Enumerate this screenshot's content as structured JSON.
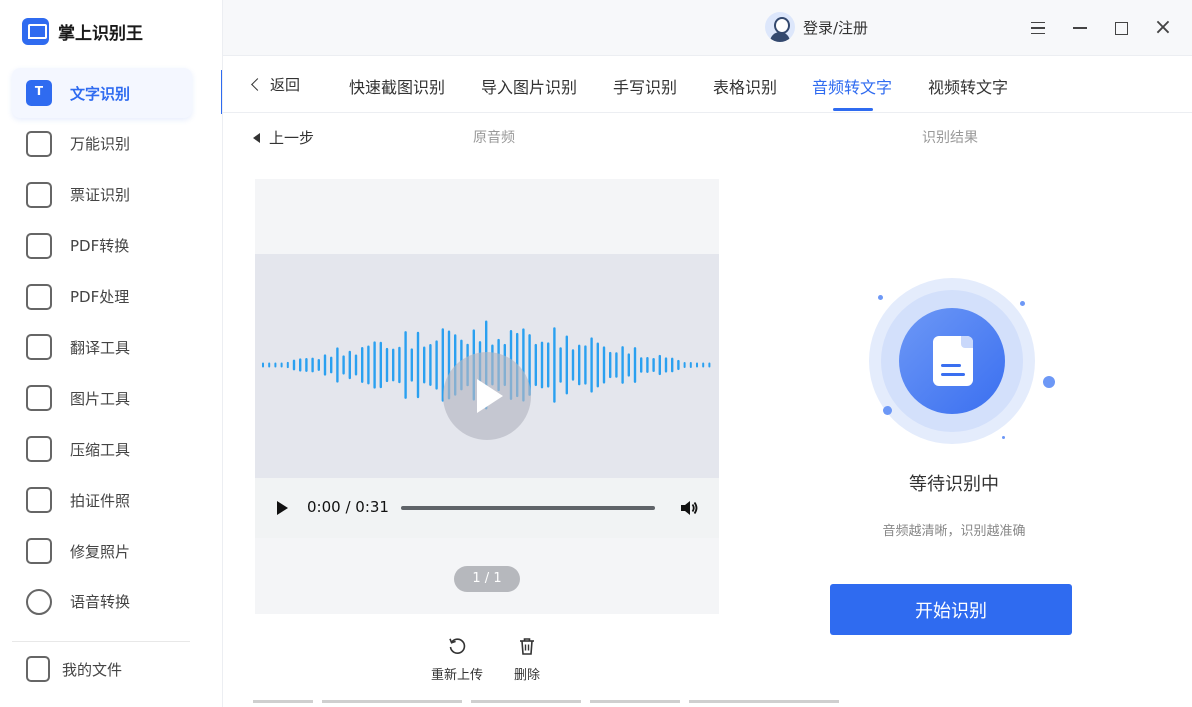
{
  "app": {
    "name": "掌上识别王"
  },
  "sidebar": {
    "items": [
      {
        "label": "文字识别",
        "icon": "text-recognition-icon",
        "active": true
      },
      {
        "label": "万能识别",
        "icon": "universal-scan-icon",
        "active": false
      },
      {
        "label": "票证识别",
        "icon": "ticket-icon",
        "active": false
      },
      {
        "label": "PDF转换",
        "icon": "pdf-convert-icon",
        "active": false
      },
      {
        "label": "PDF处理",
        "icon": "pdf-process-icon",
        "active": false
      },
      {
        "label": "翻译工具",
        "icon": "translate-icon",
        "active": false
      },
      {
        "label": "图片工具",
        "icon": "image-tools-icon",
        "active": false
      },
      {
        "label": "压缩工具",
        "icon": "compress-icon",
        "active": false
      },
      {
        "label": "拍证件照",
        "icon": "id-photo-icon",
        "active": false
      },
      {
        "label": "修复照片",
        "icon": "repair-photo-icon",
        "active": false
      },
      {
        "label": "语音转换",
        "icon": "voice-convert-icon",
        "active": false
      }
    ],
    "my_files": "我的文件"
  },
  "header": {
    "user_label": "登录/注册"
  },
  "tabs": {
    "back_label": "返回",
    "items": [
      {
        "label": "快速截图识别",
        "active": false
      },
      {
        "label": "导入图片识别",
        "active": false
      },
      {
        "label": "手写识别",
        "active": false
      },
      {
        "label": "表格识别",
        "active": false
      },
      {
        "label": "音频转文字",
        "active": true
      },
      {
        "label": "视频转文字",
        "active": false
      }
    ]
  },
  "subheader": {
    "prev_step": "上一步",
    "original_audio": "原音频",
    "result_label": "识别结果"
  },
  "player": {
    "time": "0:00 / 0:31",
    "progress": 0,
    "pager": "1 / 1"
  },
  "actions": {
    "reupload": "重新上传",
    "delete": "删除"
  },
  "result": {
    "status": "等待识别中",
    "hint": "音频越清晰，识别越准确",
    "start_button": "开始识别"
  },
  "colors": {
    "accent": "#2f6bf0",
    "wave": "#2aa0f0"
  }
}
